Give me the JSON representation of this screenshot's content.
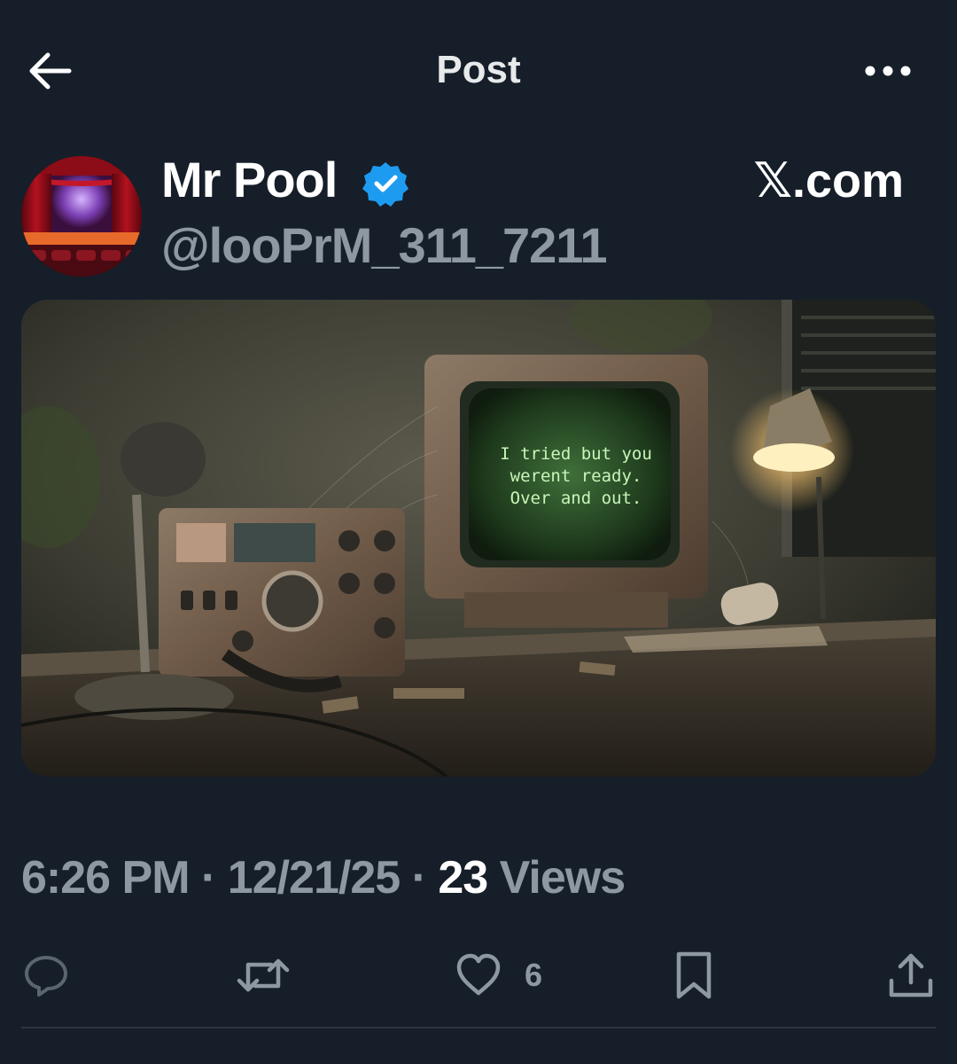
{
  "header": {
    "title": "Post",
    "back_icon": "arrow-left-icon",
    "more_icon": "more-horizontal-icon"
  },
  "author": {
    "display_name": "Mr Pool",
    "handle": "@looPrM_311_7211",
    "verified": true,
    "site_label": "𝕏.com"
  },
  "media": {
    "screen_text": [
      "I tried  but you",
      "werent  ready.",
      "Over and out."
    ]
  },
  "meta": {
    "time": "6:26 PM",
    "separator": " · ",
    "date": "12/21/25",
    "views_count": "23",
    "views_label": " Views"
  },
  "actions": {
    "reply_icon": "reply-icon",
    "repost_icon": "repost-icon",
    "like_icon": "heart-icon",
    "like_count": "6",
    "bookmark_icon": "bookmark-icon",
    "share_icon": "share-icon"
  },
  "colors": {
    "background": "#161e29",
    "text_primary": "#ffffff",
    "text_secondary": "#8e98a3",
    "verified_blue": "#1d9bf0"
  }
}
